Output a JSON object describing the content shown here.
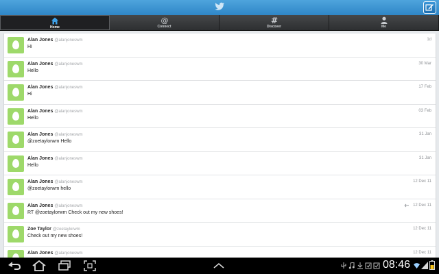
{
  "header": {
    "compose_icon": "compose-icon",
    "logo_icon": "twitter-bird-icon"
  },
  "tabs": [
    {
      "label": "Home",
      "icon": "home-icon"
    },
    {
      "label": "Connect",
      "icon": "at-icon"
    },
    {
      "label": "Discover",
      "icon": "hash-icon"
    },
    {
      "label": "Me",
      "icon": "person-icon"
    }
  ],
  "tweets": [
    {
      "name": "Alan Jones",
      "handle": "@alanjoneswm",
      "text": "Hi",
      "time": "1d"
    },
    {
      "name": "Alan Jones",
      "handle": "@alanjoneswm",
      "text": "Hello",
      "time": "30 Mar"
    },
    {
      "name": "Alan Jones",
      "handle": "@alanjoneswm",
      "text": "Hi",
      "time": "17 Feb"
    },
    {
      "name": "Alan Jones",
      "handle": "@alanjoneswm",
      "text": "Hello",
      "time": "03 Feb"
    },
    {
      "name": "Alan Jones",
      "handle": "@alanjoneswm",
      "text": "@zoetaylorwm Hello",
      "time": "31 Jan"
    },
    {
      "name": "Alan Jones",
      "handle": "@alanjoneswm",
      "text": "Hello",
      "time": "31 Jan"
    },
    {
      "name": "Alan Jones",
      "handle": "@alanjoneswm",
      "text": "@zoetaylorwm hello",
      "time": "12 Dec 11"
    },
    {
      "name": "Alan Jones",
      "handle": "@alanjoneswm",
      "text": "RT @zoetaylorwm Check out my new shoes!",
      "time": "12 Dec 11",
      "retweet_icon": "retweet-icon"
    },
    {
      "name": "Zoe Taylor",
      "handle": "@zoetaylorwm",
      "text": "Check out my new shoes!",
      "time": "12 Dec 11"
    },
    {
      "name": "Alan Jones",
      "handle": "@alanjoneswm",
      "text": "",
      "time": "12 Dec 11"
    }
  ],
  "system_bar": {
    "clock": "08:46"
  },
  "colors": {
    "header_blue": "#2f86c6",
    "avatar_green": "#9ed96a",
    "tab_bar": "#1e1f21"
  }
}
